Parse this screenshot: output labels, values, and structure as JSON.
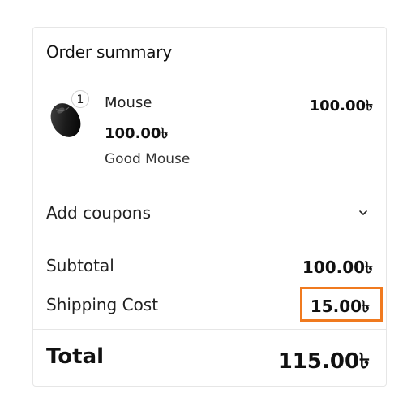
{
  "summary": {
    "title": "Order summary",
    "item": {
      "quantity": "1",
      "name": "Mouse",
      "unit_price": "100.00৳",
      "description": "Good Mouse",
      "line_total": "100.00৳",
      "image_icon": "mouse-product-image"
    },
    "coupons": {
      "label": "Add coupons",
      "icon": "chevron-down-icon"
    },
    "subtotal": {
      "label": "Subtotal",
      "value": "100.00৳"
    },
    "shipping": {
      "label": "Shipping Cost",
      "value": "15.00৳"
    },
    "total": {
      "label": "Total",
      "value": "115.00৳"
    }
  },
  "colors": {
    "highlight": "#f07a1f",
    "border": "#e6e6e6"
  }
}
